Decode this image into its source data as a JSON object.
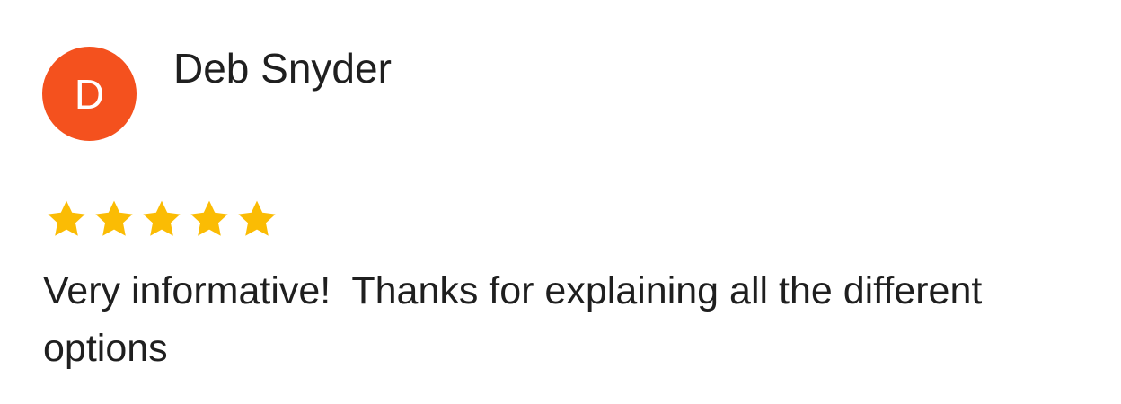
{
  "review": {
    "avatar_initial": "D",
    "avatar_color": "#f4511e",
    "author_name": "Deb Snyder",
    "rating": 5,
    "rating_max": 5,
    "star_color": "#fbbc04",
    "star_icon": "star-icon",
    "text": "Very informative!  Thanks for explaining all the different options"
  }
}
